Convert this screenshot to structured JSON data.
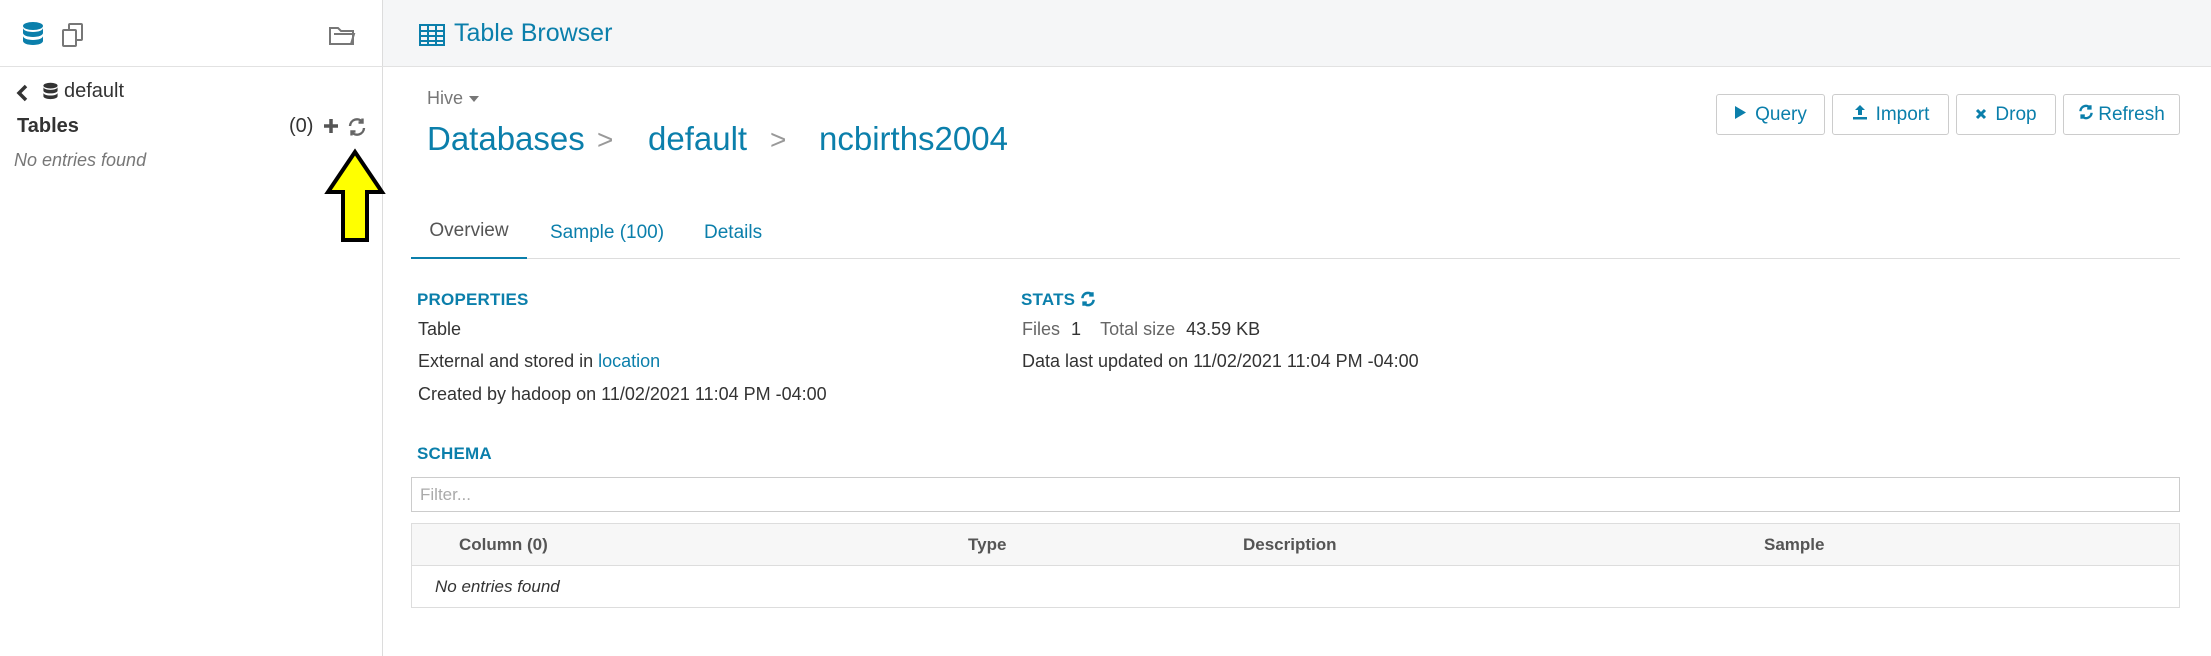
{
  "sidebar": {
    "database_name": "default",
    "tables_label": "Tables",
    "tables_count": "(0)",
    "empty_text": "No entries found"
  },
  "header": {
    "title": "Table Browser"
  },
  "source": {
    "label": "Hive"
  },
  "breadcrumb": {
    "databases": "Databases",
    "sep1": ">",
    "database": "default",
    "sep2": ">",
    "table": "ncbirths2004"
  },
  "actions": {
    "query": "Query",
    "import": "Import",
    "drop": "Drop",
    "refresh": "Refresh"
  },
  "tabs": [
    {
      "label": "Overview",
      "active": true
    },
    {
      "label": "Sample (100)",
      "active": false
    },
    {
      "label": "Details",
      "active": false
    }
  ],
  "properties": {
    "title": "PROPERTIES",
    "type": "Table",
    "stored_prefix": "External and stored in",
    "location_link": "location",
    "created": "Created by hadoop on 11/02/2021 11:04 PM -04:00"
  },
  "stats": {
    "title": "STATS",
    "files_label": "Files",
    "files_value": "1",
    "size_label": "Total size",
    "size_value": "43.59 KB",
    "updated": "Data last updated on 11/02/2021 11:04 PM -04:00"
  },
  "schema": {
    "title": "SCHEMA",
    "filter_placeholder": "Filter...",
    "columns": [
      "Column (0)",
      "Type",
      "Description",
      "Sample"
    ],
    "empty_text": "No entries found"
  },
  "colors": {
    "accent": "#0b7fab",
    "arrow_fill": "#ffff00"
  },
  "icons": [
    "database-icon",
    "documents-icon",
    "folder-open-icon",
    "chevron-left-icon",
    "plus-icon",
    "refresh-icon",
    "table-grid-icon",
    "caret-down-icon",
    "play-icon",
    "upload-icon",
    "close-icon",
    "arrow-up-annotation"
  ]
}
